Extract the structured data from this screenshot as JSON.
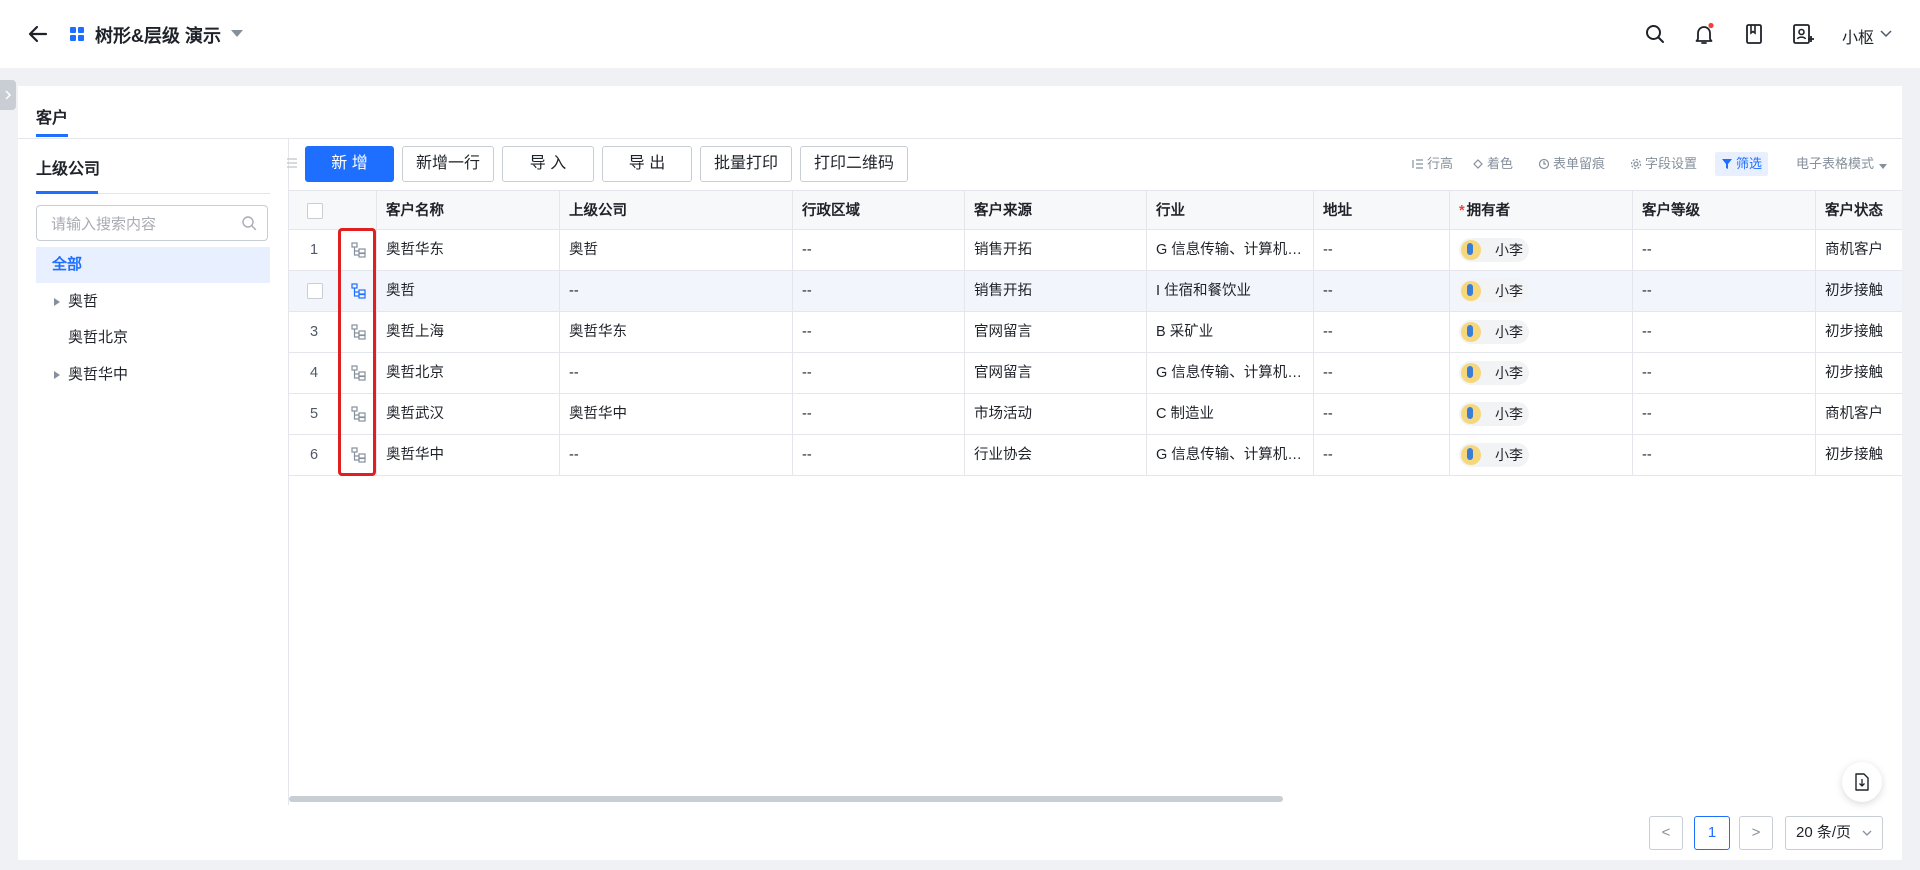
{
  "header": {
    "title": "树形&层级 演示",
    "user_name": "小枢",
    "icons": [
      "back-arrow-icon",
      "app-grid-icon",
      "search-icon",
      "bell-icon",
      "book-icon",
      "user-add-icon"
    ],
    "accent_color": "#1e6fff",
    "notification_dot_color": "#f53f3f"
  },
  "tabs": [
    {
      "label": "客户",
      "active": true
    }
  ],
  "left_panel": {
    "title": "上级公司",
    "search_placeholder": "请输入搜索内容",
    "items": [
      {
        "label": "全部",
        "active": true,
        "expandable": false
      },
      {
        "label": "奥哲",
        "active": false,
        "expandable": true
      },
      {
        "label": "奥哲北京",
        "active": false,
        "expandable": false
      },
      {
        "label": "奥哲华中",
        "active": false,
        "expandable": true
      }
    ]
  },
  "toolbar": {
    "buttons": [
      "新 增",
      "新增一行",
      "导 入",
      "导 出",
      "批量打印",
      "打印二维码"
    ],
    "tools": [
      "行高",
      "着色",
      "表单留痕",
      "字段设置",
      "筛选"
    ],
    "mode": "电子表格模式"
  },
  "table": {
    "columns": [
      "客户名称",
      "上级公司",
      "行政区域",
      "客户来源",
      "行业",
      "地址",
      "拥有者",
      "客户等级",
      "客户状态"
    ],
    "required_column": "拥有者",
    "rows": [
      {
        "no": "1",
        "name": "奥哲华东",
        "parent": "奥哲",
        "region": "--",
        "source": "销售开拓",
        "industry": "G 信息传输、计算机服务和软件业",
        "address": "--",
        "owner": "小李",
        "level": "--",
        "status": "商机客户"
      },
      {
        "no": "",
        "name": "奥哲",
        "parent": "--",
        "region": "--",
        "source": "销售开拓",
        "industry": "I 住宿和餐饮业",
        "address": "--",
        "owner": "小李",
        "level": "--",
        "status": "初步接触"
      },
      {
        "no": "3",
        "name": "奥哲上海",
        "parent": "奥哲华东",
        "region": "--",
        "source": "官网留言",
        "industry": "B 采矿业",
        "address": "--",
        "owner": "小李",
        "level": "--",
        "status": "初步接触"
      },
      {
        "no": "4",
        "name": "奥哲北京",
        "parent": "--",
        "region": "--",
        "source": "官网留言",
        "industry": "G 信息传输、计算机服务和软件业",
        "address": "--",
        "owner": "小李",
        "level": "--",
        "status": "初步接触"
      },
      {
        "no": "5",
        "name": "奥哲武汉",
        "parent": "奥哲华中",
        "region": "--",
        "source": "市场活动",
        "industry": "C 制造业",
        "address": "--",
        "owner": "小李",
        "level": "--",
        "status": "商机客户"
      },
      {
        "no": "6",
        "name": "奥哲华中",
        "parent": "--",
        "region": "--",
        "source": "行业协会",
        "industry": "G 信息传输、计算机服务和软件业",
        "address": "--",
        "owner": "小李",
        "level": "--",
        "status": "初步接触"
      }
    ]
  },
  "pagination": {
    "prev": "<",
    "current_page": "1",
    "next": ">",
    "page_size": "20 条/页"
  }
}
